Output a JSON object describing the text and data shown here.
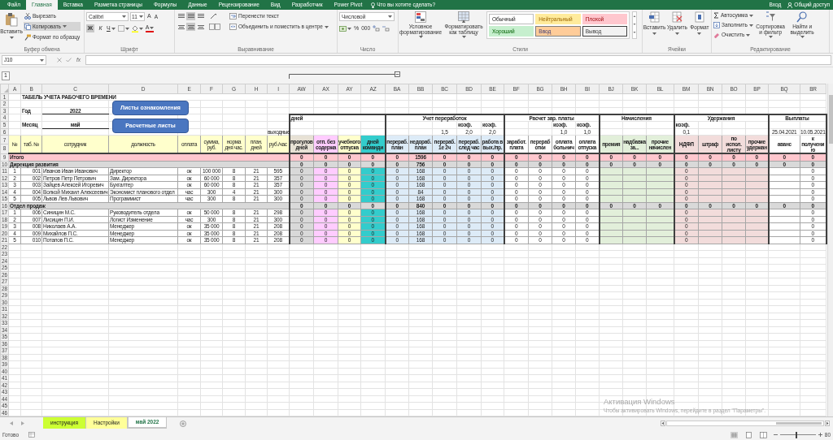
{
  "ribbon_tabs": [
    {
      "label": "Файл",
      "selected": false
    },
    {
      "label": "Главная",
      "selected": true
    },
    {
      "label": "Вставка",
      "selected": false
    },
    {
      "label": "Разметка страницы",
      "selected": false
    },
    {
      "label": "Формулы",
      "selected": false
    },
    {
      "label": "Данные",
      "selected": false
    },
    {
      "label": "Рецензирование",
      "selected": false
    },
    {
      "label": "Вид",
      "selected": false
    },
    {
      "label": "Разработчик",
      "selected": false
    },
    {
      "label": "Power Pivot",
      "selected": false
    }
  ],
  "tell_me": "Что вы хотите сделать?",
  "account": {
    "sign_in": "Вход",
    "share": "Общий доступ"
  },
  "ribbon": {
    "clipboard": {
      "label": "Буфер обмена",
      "paste": "Вставить",
      "cut": "Вырезать",
      "copy": {
        "text": "Копировать",
        "highlighted": true
      },
      "format_painter": "Формат по образцу"
    },
    "font": {
      "label": "Шрифт",
      "name": "Calibri",
      "size": "11",
      "grow": "A",
      "shrink": "A",
      "bold": {
        "text": "Ж",
        "pressed": true
      },
      "italic": "К",
      "underline": "Ч",
      "font_color": "A"
    },
    "alignment": {
      "label": "Выравнивание",
      "align_buttons": [
        [
          {
            "pressed": false
          },
          {
            "pressed": true
          },
          {
            "pressed": false
          }
        ],
        [
          {
            "pressed": false
          },
          {
            "pressed": true
          },
          {
            "pressed": false
          }
        ]
      ],
      "wrap": "Перенести текст",
      "merge": "Объединить и поместить в центре"
    },
    "number": {
      "label": "Число",
      "format": "Числовой",
      "percent": "%",
      "thousands": "000"
    },
    "styles": {
      "label": "Стили",
      "conditional": "Условное форматирование",
      "as_table": "Форматировать как таблицу",
      "gallery": [
        {
          "label": "Обычный",
          "kind": "normal"
        },
        {
          "label": "Нейтральный",
          "kind": "neutral"
        },
        {
          "label": "Плохой",
          "kind": "bad"
        },
        {
          "label": "Хороший",
          "kind": "good"
        },
        {
          "label": "Ввод",
          "kind": "input"
        },
        {
          "label": "Вывод",
          "kind": "output"
        }
      ]
    },
    "cells": {
      "label": "Ячейки",
      "buttons": [
        "Вставить",
        "Удалить",
        "Формат"
      ]
    },
    "editing": {
      "label": "Редактирование",
      "autosum": "Автосумма",
      "fill": "Заполнить",
      "clear": "Очистить",
      "sort": "Сортировка и фильтр",
      "find": "Найти и выделить"
    }
  },
  "formula_bar": {
    "name_box": "J10",
    "function_label": "fx"
  },
  "outline": {
    "button": "1"
  },
  "sheet": {
    "columns": [
      {
        "letter": "A"
      },
      {
        "letter": "B"
      },
      {
        "letter": "C"
      },
      {
        "letter": "D"
      },
      {
        "letter": "E"
      },
      {
        "letter": "F"
      },
      {
        "letter": "G"
      },
      {
        "letter": "H"
      },
      {
        "letter": "I"
      },
      {
        "letter": "AW",
        "color": "#d9d9d9"
      },
      {
        "letter": "AX",
        "color": "#ffccff"
      },
      {
        "letter": "AY",
        "color": "#ffffcc"
      },
      {
        "letter": "AZ",
        "color": "#33cccc"
      },
      {
        "letter": "BA",
        "color": "#ddebf7"
      },
      {
        "letter": "BB",
        "color": "#ddebf7"
      },
      {
        "letter": "BC",
        "color": "#ddebf7"
      },
      {
        "letter": "BD",
        "color": "#ddebf7"
      },
      {
        "letter": "BE",
        "color": "#ddebf7"
      },
      {
        "letter": "BF"
      },
      {
        "letter": "BG"
      },
      {
        "letter": "BH"
      },
      {
        "letter": "BI"
      },
      {
        "letter": "BJ",
        "color": "#e2efda"
      },
      {
        "letter": "BK",
        "color": "#e2efda"
      },
      {
        "letter": "BL",
        "color": "#e2efda"
      },
      {
        "letter": "BM",
        "color": "#f2dcdb"
      },
      {
        "letter": "BN",
        "color": "#f2dcdb"
      },
      {
        "letter": "BO",
        "color": "#f2dcdb"
      },
      {
        "letter": "BP",
        "color": "#f2dcdb"
      },
      {
        "letter": "BQ"
      },
      {
        "letter": "BR"
      }
    ],
    "rows": [
      {
        "number": "1",
        "kind": "plain",
        "cells": [
          null,
          {
            "text": "ТАБЕЛЬ УЧЕТА РАБОЧЕГО ВРЕМЕНИ",
            "kind": "title"
          }
        ]
      },
      {
        "number": "2",
        "kind": "plain"
      },
      {
        "number": "3",
        "kind": "plain",
        "cells": [
          null,
          {
            "text": "Год",
            "kind": "label"
          },
          {
            "text": "2022",
            "kind": "field"
          }
        ]
      },
      {
        "number": "4",
        "kind": "band",
        "cells": [
          null,
          null,
          null,
          null,
          null,
          null,
          null,
          null,
          null,
          "дней",
          null,
          null,
          null,
          "Учет переработок",
          null,
          null,
          null,
          null,
          "Расчет зар. платы",
          null,
          null,
          null,
          "Начисления",
          null,
          null,
          "Удержания",
          null,
          null,
          null,
          "Выплаты"
        ]
      },
      {
        "number": "5",
        "kind": "sub",
        "cells": [
          null,
          {
            "text": "Месяц",
            "kind": "label"
          },
          {
            "text": "май",
            "kind": "field"
          },
          null,
          null,
          null,
          null,
          null,
          null,
          null,
          null,
          null,
          null,
          null,
          null,
          null,
          {
            "text": "коэф.",
            "kind": "note"
          },
          {
            "text": "коэф.",
            "kind": "note"
          },
          null,
          null,
          {
            "text": "коэф.",
            "kind": "note"
          },
          {
            "text": "коэф.",
            "kind": "note"
          },
          null,
          null,
          null,
          {
            "text": "коэф.",
            "kind": "note"
          }
        ]
      },
      {
        "number": "6",
        "kind": "sub",
        "cells": [
          null,
          null,
          null,
          null,
          null,
          null,
          null,
          null,
          {
            "text": "выходные",
            "kind": "note"
          },
          null,
          null,
          null,
          null,
          null,
          null,
          "1,5",
          "2,0",
          "2,0",
          null,
          null,
          "1,0",
          "1,0",
          null,
          null,
          null,
          "0,1",
          null,
          null,
          null,
          "25.04.2021",
          "10.05.2021"
        ]
      },
      {
        "numbers": [
          "7",
          "8"
        ],
        "kind": "header",
        "cells": [
          {
            "text": "№",
            "color": "#ffffcc"
          },
          {
            "text": "таб. №",
            "color": "#ffffcc"
          },
          {
            "text": "сотрудник",
            "color": "#ffffcc"
          },
          {
            "text": "должность",
            "color": "#ffffcc"
          },
          {
            "text": "оплата",
            "color": "#ffffcc"
          },
          {
            "text": "сумма, руб.",
            "color": "#ffffcc"
          },
          {
            "text": "норма дня час.",
            "color": "#ffffcc"
          },
          {
            "text": "план. дней",
            "color": "#ffffcc"
          },
          {
            "text": "руб./час",
            "color": "#ffffcc"
          },
          {
            "text": "прогулов дней",
            "color": "#e7e1d5"
          },
          {
            "text": "отп. без содержа",
            "color": "#ffccff"
          },
          {
            "text": "учебного отпуска",
            "color": "#ffffcc"
          },
          {
            "text": "дней команди",
            "color": "#33cccc"
          },
          {
            "text": "перераб. план",
            "color": "#ddebf7"
          },
          {
            "text": "недораб. план",
            "color": "#ddebf7"
          },
          {
            "text": "перераб. 1е 2ч",
            "color": "#ddebf7"
          },
          {
            "text": "перераб. след час",
            "color": "#ddebf7"
          },
          {
            "text": "работа в вых./пр.",
            "color": "#ddebf7"
          },
          {
            "text": "заработ. плата"
          },
          {
            "text": "переработки"
          },
          {
            "text": "оплата больнич"
          },
          {
            "text": "оплата отпуска"
          },
          {
            "text": "премия",
            "color": "#e2efda"
          },
          {
            "text": "надбавка за...",
            "color": "#e2efda"
          },
          {
            "text": "прочие начислен",
            "color": "#e2efda"
          },
          {
            "text": "НДФЛ",
            "color": "#f2dcdb"
          },
          {
            "text": "штраф",
            "color": "#f2dcdb"
          },
          {
            "text": "по испол. листу",
            "color": "#f2dcdb"
          },
          {
            "text": "прочие удержан",
            "color": "#f2dcdb"
          },
          {
            "text": "аванс"
          },
          {
            "text": "к получению"
          }
        ]
      },
      {
        "number": "9",
        "kind": "total",
        "cells": [
          "Итого",
          null,
          null,
          null,
          null,
          null,
          null,
          null,
          null,
          "0",
          "0",
          "0",
          "0",
          "0",
          "1596",
          "0",
          "0",
          "0",
          "0",
          "0",
          "0",
          "0",
          "0",
          "0",
          "0",
          "0",
          "0",
          "0",
          "0",
          "0",
          "0"
        ]
      },
      {
        "number": "10",
        "kind": "group",
        "cells": [
          "Дирекция развития",
          null,
          null,
          null,
          null,
          null,
          null,
          null,
          null,
          "0",
          "0",
          "0",
          "0",
          "0",
          "756",
          "0",
          "0",
          "0",
          "0",
          "0",
          "0",
          "0",
          "0",
          "0",
          "0",
          "0",
          "0",
          "0",
          "0",
          "0",
          "0"
        ]
      },
      {
        "number": "11",
        "kind": "item",
        "cells": [
          "1",
          "001",
          "Иванов Иван Иванович",
          "Директор",
          "ок",
          "100 000",
          "8",
          "21",
          "595",
          "0",
          "0",
          "0",
          "0",
          "0",
          "168",
          "0",
          "0",
          "0",
          "0",
          "0",
          "0",
          "0",
          null,
          null,
          null,
          "0",
          null,
          null,
          null,
          null,
          "0"
        ]
      },
      {
        "number": "12",
        "kind": "item",
        "cells": [
          "2",
          "002",
          "Петров Петр Петрович",
          "Зам. Директора",
          "ок",
          "60 000",
          "8",
          "21",
          "357",
          "0",
          "0",
          "0",
          "0",
          "0",
          "168",
          "0",
          "0",
          "0",
          "0",
          "0",
          "0",
          "0",
          null,
          null,
          null,
          "0",
          null,
          null,
          null,
          null,
          "0"
        ]
      },
      {
        "number": "13",
        "kind": "item",
        "cells": [
          "3",
          "003",
          "Зайцев Алексей Игоревич",
          "Бухгалтер",
          "ок",
          "60 000",
          "8",
          "21",
          "357",
          "0",
          "0",
          "0",
          "0",
          "0",
          "168",
          "0",
          "0",
          "0",
          "0",
          "0",
          "0",
          "0",
          null,
          null,
          null,
          "0",
          null,
          null,
          null,
          null,
          "0"
        ]
      },
      {
        "number": "14",
        "kind": "item",
        "cells": [
          "4",
          "004",
          "Волкой Михаил Алексеевич",
          "Экономист планового отдел",
          "час",
          "300",
          "4",
          "21",
          "300",
          "0",
          "0",
          "0",
          "0",
          "0",
          "84",
          "0",
          "0",
          "0",
          "0",
          "0",
          "0",
          "0",
          null,
          null,
          null,
          "0",
          null,
          null,
          null,
          null,
          "0"
        ]
      },
      {
        "number": "15",
        "kind": "item",
        "cells": [
          "5",
          "005",
          "Львов Лев Львович",
          "Программист",
          "час",
          "300",
          "8",
          "21",
          "300",
          "0",
          "0",
          "0",
          "0",
          "0",
          "168",
          "0",
          "0",
          "0",
          "0",
          "0",
          "0",
          "0",
          null,
          null,
          null,
          "0",
          null,
          null,
          null,
          null,
          "0"
        ]
      },
      {
        "number": "16",
        "kind": "group",
        "cells": [
          "Отдел продаж",
          null,
          null,
          null,
          null,
          null,
          null,
          null,
          null,
          "0",
          "0",
          "0",
          "0",
          "0",
          "840",
          "0",
          "0",
          "0",
          "0",
          "0",
          "0",
          "0",
          "0",
          "0",
          "0",
          "0",
          "0",
          "0",
          "0",
          "0",
          "0"
        ]
      },
      {
        "number": "17",
        "kind": "item",
        "cells": [
          "1",
          "006",
          "Синицин М.С.",
          "Руководитель отдела",
          "ок",
          "50 000",
          "8",
          "21",
          "298",
          "0",
          "0",
          "0",
          "0",
          "0",
          "168",
          "0",
          "0",
          "0",
          "0",
          "0",
          "0",
          "0",
          null,
          null,
          null,
          "0",
          null,
          null,
          null,
          null,
          "0"
        ]
      },
      {
        "number": "18",
        "kind": "item",
        "cells": [
          "2",
          "007",
          "Лисицин П.И.",
          "Логист Изменение",
          "час",
          "300",
          "8",
          "21",
          "300",
          "0",
          "0",
          "0",
          "0",
          "0",
          "168",
          "0",
          "0",
          "0",
          "0",
          "0",
          "0",
          "0",
          null,
          null,
          null,
          "0",
          null,
          null,
          null,
          null,
          "0"
        ]
      },
      {
        "number": "19",
        "kind": "item",
        "cells": [
          "3",
          "008",
          "Николаев А.А.",
          "Менеджер",
          "ок",
          "35 000",
          "8",
          "21",
          "208",
          "0",
          "0",
          "0",
          "0",
          "0",
          "168",
          "0",
          "0",
          "0",
          "0",
          "0",
          "0",
          "0",
          null,
          null,
          null,
          "0",
          null,
          null,
          null,
          null,
          "0"
        ]
      },
      {
        "number": "20",
        "kind": "item",
        "cells": [
          "4",
          "009",
          "Михайлов П.С.",
          "Менеджер",
          "ок",
          "35 000",
          "8",
          "21",
          "208",
          "0",
          "0",
          "0",
          "0",
          "0",
          "168",
          "0",
          "0",
          "0",
          "0",
          "0",
          "0",
          "0",
          null,
          null,
          null,
          "0",
          null,
          null,
          null,
          null,
          "0"
        ]
      },
      {
        "number": "21",
        "kind": "item",
        "cells": [
          "5",
          "010",
          "Потапов П.С.",
          "Менеджер",
          "ок",
          "35 000",
          "8",
          "21",
          "208",
          "0",
          "0",
          "0",
          "0",
          "0",
          "168",
          "0",
          "0",
          "0",
          "0",
          "0",
          "0",
          "0",
          null,
          null,
          null,
          "0",
          null,
          null,
          null,
          null,
          "0"
        ]
      },
      {
        "number": "22",
        "kind": "blank"
      },
      {
        "number": "23",
        "kind": "blank"
      },
      {
        "number": "24",
        "kind": "blank"
      },
      {
        "number": "25",
        "kind": "blank"
      },
      {
        "number": "26",
        "kind": "blank"
      },
      {
        "number": "27",
        "kind": "blank"
      },
      {
        "number": "28",
        "kind": "blank"
      },
      {
        "number": "29",
        "kind": "blank"
      },
      {
        "number": "30",
        "kind": "blank"
      },
      {
        "number": "31",
        "kind": "blank"
      },
      {
        "number": "32",
        "kind": "blank"
      },
      {
        "number": "33",
        "kind": "blank"
      },
      {
        "number": "34",
        "kind": "blank"
      },
      {
        "number": "35",
        "kind": "blank"
      },
      {
        "number": "36",
        "kind": "blank"
      },
      {
        "number": "37",
        "kind": "blank"
      },
      {
        "number": "38",
        "kind": "blank"
      },
      {
        "number": "39",
        "kind": "blank"
      },
      {
        "number": "40",
        "kind": "blank"
      },
      {
        "number": "41",
        "kind": "blank"
      },
      {
        "number": "42",
        "kind": "blank"
      },
      {
        "number": "43",
        "kind": "blank"
      },
      {
        "number": "44",
        "kind": "blank"
      },
      {
        "number": "45",
        "kind": "blank"
      },
      {
        "number": "46",
        "kind": "blank"
      }
    ],
    "buttons": [
      "Листы ознакомления",
      "Расчетные листы"
    ]
  },
  "sheet_tabs": [
    {
      "label": "инструкция",
      "selected": false,
      "color": "#ccff33"
    },
    {
      "label": "Настройки",
      "selected": false,
      "color": "#ffff99"
    },
    {
      "label": "май 2022",
      "selected": true
    }
  ],
  "status_bar": {
    "text": "Готово",
    "zoom": "80",
    "zoom_slider": {
      "level": 0.45
    }
  },
  "activation_notice": {
    "title": "Активация Windows",
    "text": "Чтобы активировать Windows, перейдите в раздел \"Параметры\"."
  }
}
